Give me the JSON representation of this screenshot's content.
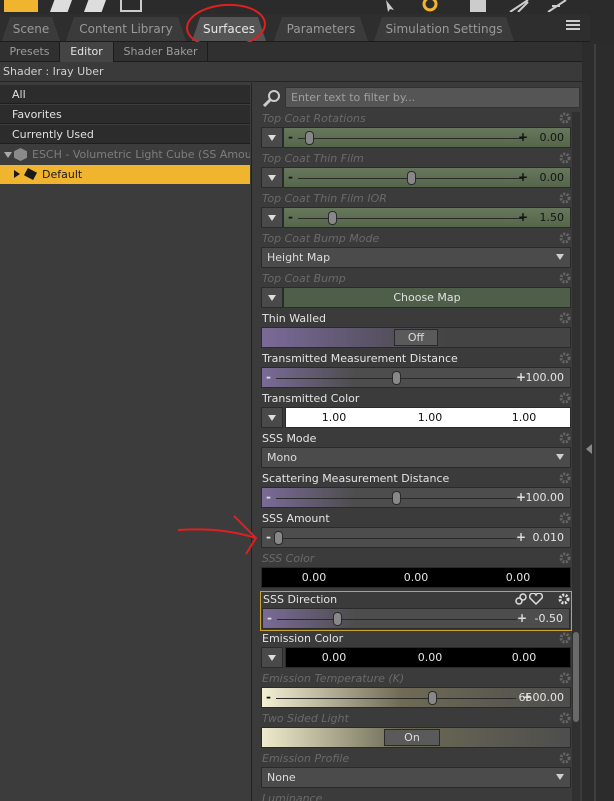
{
  "tabs": [
    "Scene",
    "Content Library",
    "Surfaces",
    "Parameters",
    "Simulation Settings"
  ],
  "active_tab": "Surfaces",
  "subtabs": [
    "Presets",
    "Editor",
    "Shader Baker"
  ],
  "active_subtab": "Editor",
  "shader_line": "Shader : Iray Uber",
  "tree": {
    "rows": [
      "All",
      "Favorites",
      "Currently Used"
    ],
    "node": "ESCH - Volumetric Light Cube (SS Amount...",
    "selected": "Default"
  },
  "filter": {
    "placeholder": "Enter text to filter by..."
  },
  "props": {
    "top_coat_rotations": {
      "label": "Top Coat Rotations",
      "value": "0.00",
      "fraction": 0.05
    },
    "top_coat_thin_film": {
      "label": "Top Coat Thin Film",
      "value": "0.00",
      "fraction": 0.5
    },
    "top_coat_thin_film_ior": {
      "label": "Top Coat Thin Film IOR",
      "value": "1.50",
      "fraction": 0.15
    },
    "top_coat_bump_mode": {
      "label": "Top Coat Bump Mode",
      "value": "Height Map"
    },
    "top_coat_bump": {
      "label": "Top Coat Bump",
      "button": "Choose Map"
    },
    "thin_walled": {
      "label": "Thin Walled",
      "value": "Off"
    },
    "transmitted_measurement_distance": {
      "label": "Transmitted Measurement Distance",
      "value": "100.00",
      "fraction": 0.5
    },
    "transmitted_color": {
      "label": "Transmitted Color",
      "r": "1.00",
      "g": "1.00",
      "b": "1.00"
    },
    "sss_mode": {
      "label": "SSS Mode",
      "value": "Mono"
    },
    "scattering_measurement_distance": {
      "label": "Scattering Measurement Distance",
      "value": "100.00",
      "fraction": 0.5
    },
    "sss_amount": {
      "label": "SSS Amount",
      "value": "0.010",
      "fraction": 0.01
    },
    "sss_color": {
      "label": "SSS Color",
      "r": "0.00",
      "g": "0.00",
      "b": "0.00"
    },
    "sss_direction": {
      "label": "SSS Direction",
      "value": "-0.50",
      "fraction": 0.25
    },
    "emission_color": {
      "label": "Emission Color",
      "r": "0.00",
      "g": "0.00",
      "b": "0.00"
    },
    "emission_temperature": {
      "label": "Emission Temperature (K)",
      "value": "6500.00",
      "fraction": 0.65
    },
    "two_sided_light": {
      "label": "Two Sided Light",
      "value": "On"
    },
    "emission_profile": {
      "label": "Emission Profile",
      "value": "None"
    },
    "luminance": {
      "label": "Luminance"
    }
  },
  "colors": {
    "accent": "#f1b42f",
    "highlight_circle": "#e02020",
    "green_slider": "#5b6e52",
    "purple_slider": "#6e5e86"
  }
}
